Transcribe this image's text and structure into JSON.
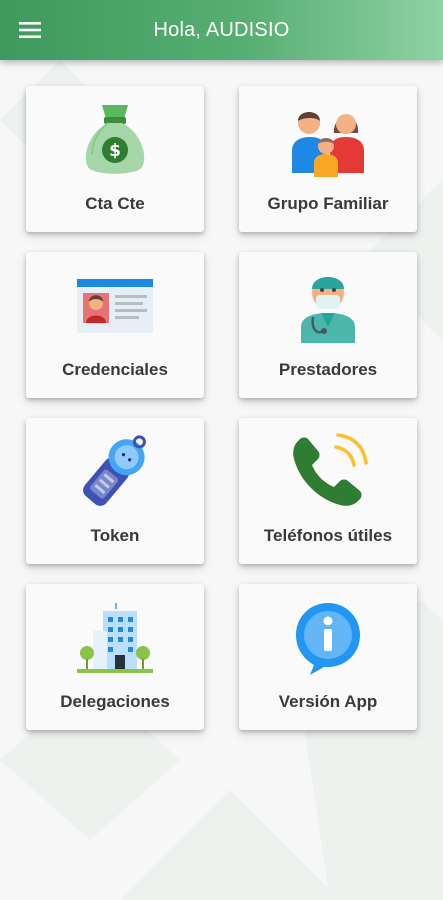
{
  "header": {
    "greeting": "Hola, AUDISIO",
    "menu_icon": "hamburger-menu-icon",
    "colors": {
      "start": "#3d9a5c",
      "end": "#8fd2a3",
      "text": "#ffffff"
    }
  },
  "tiles": [
    {
      "label": "Cta Cte",
      "icon": "money-bag-icon"
    },
    {
      "label": "Grupo Familiar",
      "icon": "family-icon"
    },
    {
      "label": "Credenciales",
      "icon": "id-card-icon"
    },
    {
      "label": "Prestadores",
      "icon": "doctor-icon"
    },
    {
      "label": "Token",
      "icon": "token-device-icon"
    },
    {
      "label": "Teléfonos útiles",
      "icon": "phone-icon"
    },
    {
      "label": "Delegaciones",
      "icon": "building-icon"
    },
    {
      "label": "Versión App",
      "icon": "info-icon"
    }
  ]
}
